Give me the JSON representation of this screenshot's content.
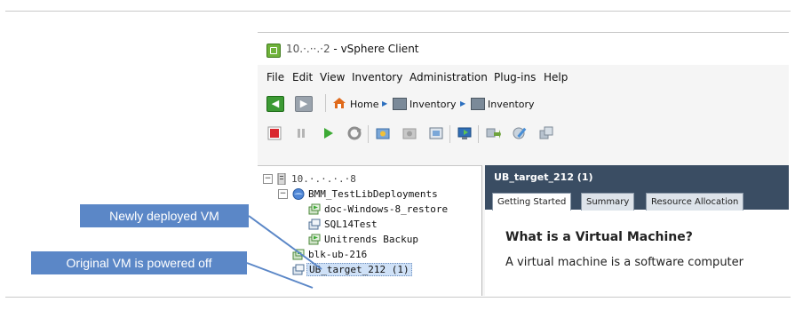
{
  "window": {
    "title_ip_obscured": "10.·.··.·2",
    "title_suffix": " - vSphere Client"
  },
  "menu": {
    "items": [
      "File",
      "Edit",
      "View",
      "Inventory",
      "Administration",
      "Plug-ins",
      "Help"
    ]
  },
  "nav": {
    "home_label": "Home",
    "crumb1_label": "Inventory",
    "crumb2_label": "Inventory"
  },
  "toolbar": {
    "icons": [
      "power-off-icon",
      "suspend-icon",
      "power-on-icon",
      "reset-icon",
      "snapshot-icon",
      "revert-snapshot-icon",
      "snapshot-manager-icon",
      "console-icon",
      "migrate-icon",
      "edit-settings-icon",
      "clone-icon"
    ]
  },
  "tree": {
    "host_label": "10.·.·.·.·8",
    "resource_pool_label": "BMM_TestLibDeployments",
    "vms": [
      "doc-Windows-8_restore",
      "SQL14Test",
      "Unitrends Backup"
    ],
    "root_vms": [
      "blk-ub-216",
      "UB_target_212 (1)"
    ]
  },
  "detail": {
    "title": "UB_target_212 (1)",
    "tabs": [
      "Getting Started",
      "Summary",
      "Resource Allocation"
    ],
    "heading": "What is a Virtual Machine?",
    "body_text": "A virtual machine is a software computer"
  },
  "callouts": {
    "newly_deployed": "Newly deployed VM",
    "original_off": "Original VM is powered off"
  },
  "colors": {
    "callout_bg": "#5b87c7",
    "detail_header_bg": "#3a4d63",
    "power_off_red": "#d9272e",
    "power_on_green": "#3daa35"
  }
}
